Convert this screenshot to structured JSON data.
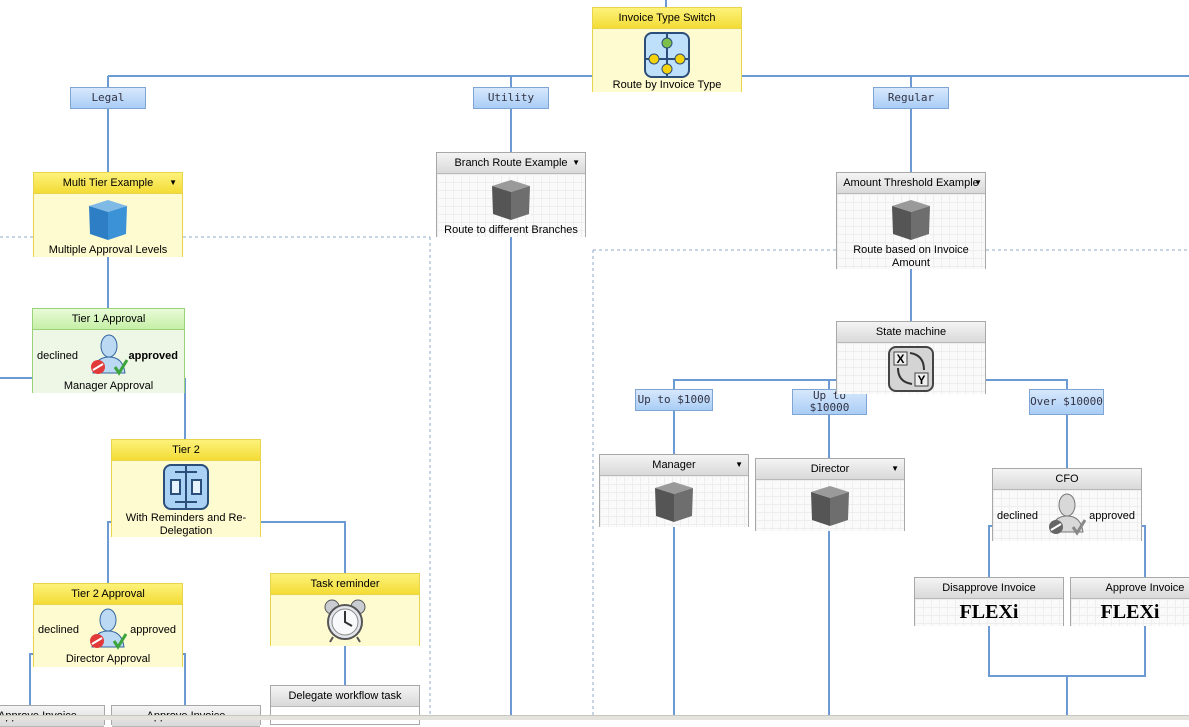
{
  "root": {
    "title": "Invoice Type Switch",
    "caption": "Route by Invoice Type",
    "icon": "switch-route-icon"
  },
  "branch_labels": {
    "legal": "Legal",
    "utility": "Utility",
    "regular": "Regular",
    "up_to_1000": "Up to $1000",
    "up_to_10000": "Up to $10000",
    "over_10000": "Over $10000"
  },
  "nodes": {
    "multi_tier": {
      "title": "Multi Tier Example",
      "caption": "Multiple Approval Levels",
      "icon": "blue-box-icon"
    },
    "tier1": {
      "title": "Tier 1 Approval",
      "caption": "Manager Approval",
      "declined": "declined",
      "approved": "approved",
      "icon": "user-approval-icon"
    },
    "tier2": {
      "title": "Tier 2",
      "caption": "With Reminders and Re-Delegation",
      "icon": "parallel-process-icon"
    },
    "tier2_approval": {
      "title": "Tier 2 Approval",
      "caption": "Director Approval",
      "declined": "declined",
      "approved": "approved",
      "icon": "user-approval-icon"
    },
    "task_reminder": {
      "title": "Task reminder",
      "icon": "alarm-clock-icon"
    },
    "delegate": {
      "title": "Delegate workflow task"
    },
    "approve_left_1": {
      "title": "Approve Invoice"
    },
    "approve_left_2": {
      "title": "Approve Invoice"
    },
    "branch_route": {
      "title": "Branch Route Example",
      "caption": "Route to different Branches",
      "icon": "gray-box-icon"
    },
    "amount_threshold": {
      "title": "Amount Threshold Example",
      "caption": "Route based on Invoice Amount",
      "icon": "gray-box-icon"
    },
    "state_machine": {
      "title": "State machine",
      "icon": "state-machine-xy-icon"
    },
    "manager": {
      "title": "Manager",
      "icon": "gray-box-icon"
    },
    "director": {
      "title": "Director",
      "icon": "gray-box-icon"
    },
    "cfo": {
      "title": "CFO",
      "declined": "declined",
      "approved": "approved",
      "icon": "user-approval-gray-icon"
    },
    "disapprove_invoice": {
      "title": "Disapprove Invoice",
      "logo": "FLEXi"
    },
    "approve_invoice": {
      "title": "Approve Invoice",
      "logo": "FLEXi"
    }
  },
  "colors": {
    "wire": "#6b9bd2",
    "yellow_header": "#f3dc36",
    "green_header": "#c5efa6",
    "blue_label": "#a9cdf5"
  }
}
